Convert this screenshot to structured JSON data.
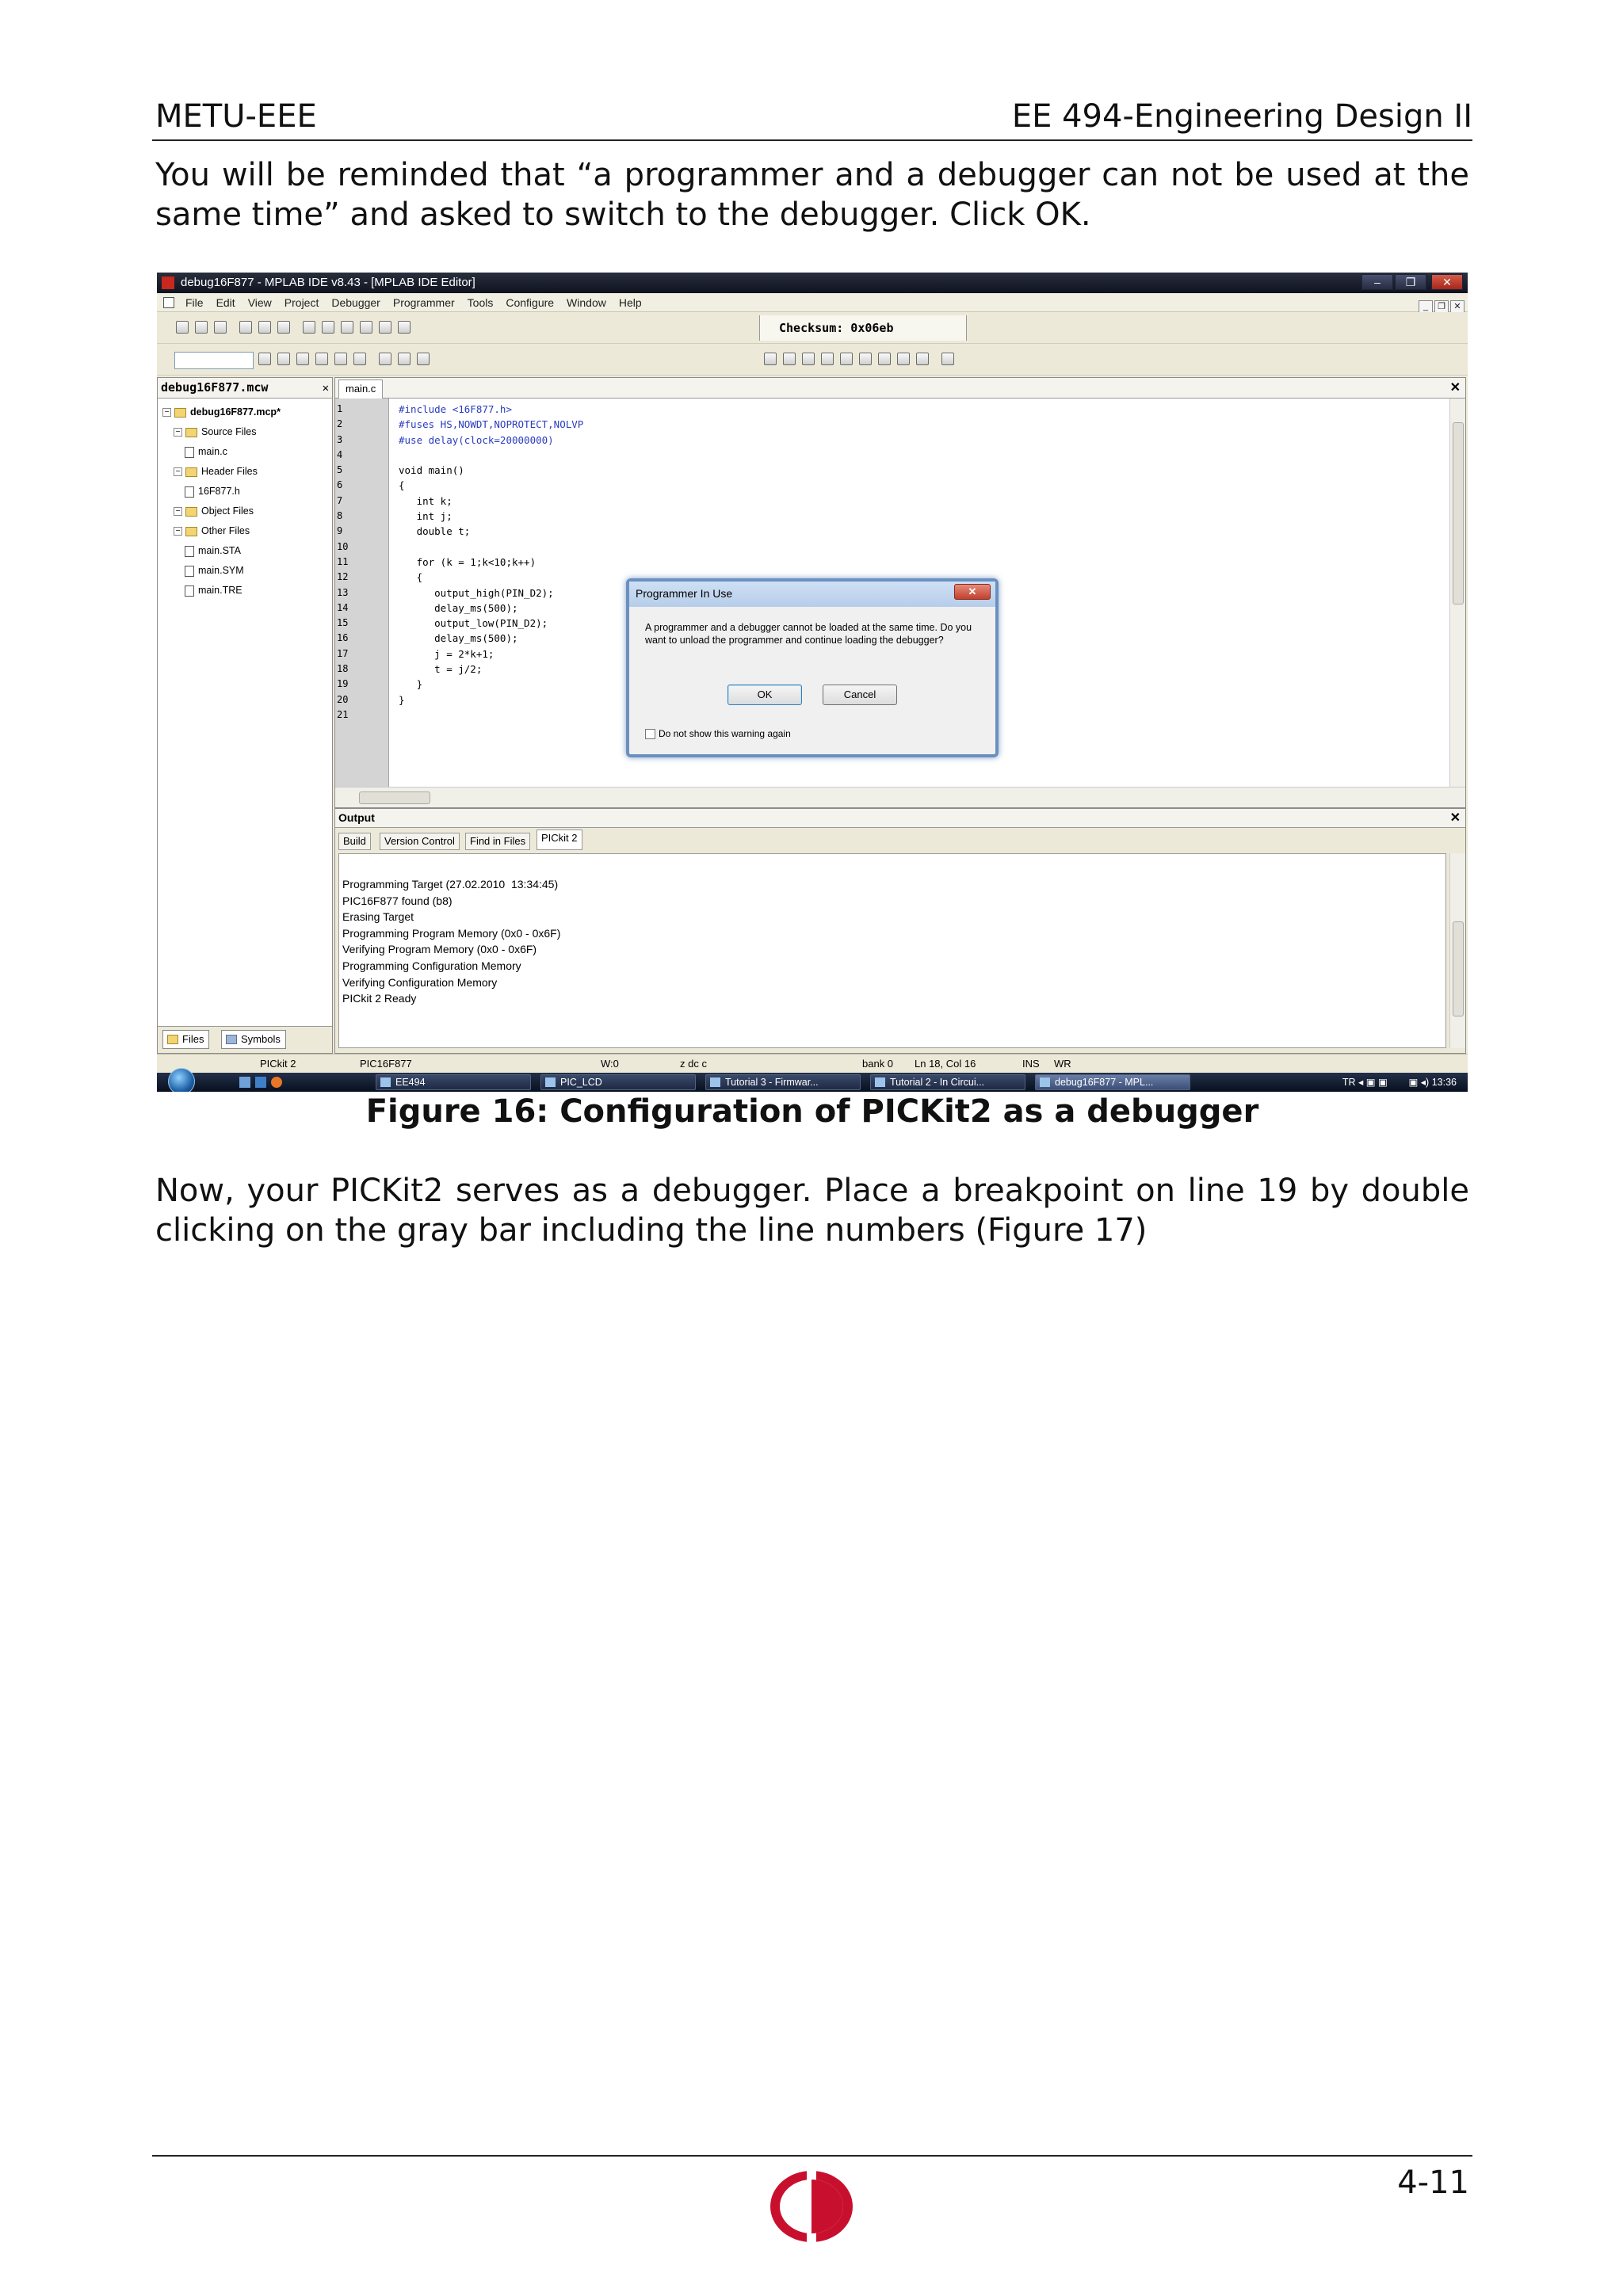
{
  "header": {
    "left": "METU-EEE",
    "right": "EE 494-Engineering Design II"
  },
  "paragraph1": "You will be reminded that “a programmer and a debugger can not be used at the same time” and asked to switch to the debugger. Click OK.",
  "figure": {
    "caption": "Figure 16: Configuration of PICKit2 as a debugger",
    "window_title": "debug16F877 - MPLAB IDE v8.43 - [MPLAB IDE Editor]",
    "menu": [
      "File",
      "Edit",
      "View",
      "Project",
      "Debugger",
      "Programmer",
      "Tools",
      "Configure",
      "Window",
      "Help"
    ],
    "checksum": "Checksum:  0x06eb",
    "project_panel": {
      "title": "debug16F877.mcw",
      "tree": [
        {
          "label": "debug16F877.mcp*",
          "kind": "folder",
          "depth": 0
        },
        {
          "label": "Source Files",
          "kind": "folder",
          "depth": 1
        },
        {
          "label": "main.c",
          "kind": "file",
          "depth": 2
        },
        {
          "label": "Header Files",
          "kind": "folder",
          "depth": 1
        },
        {
          "label": "16F877.h",
          "kind": "file",
          "depth": 2
        },
        {
          "label": "Object Files",
          "kind": "folder",
          "depth": 1
        },
        {
          "label": "Other Files",
          "kind": "folder",
          "depth": 1
        },
        {
          "label": "main.STA",
          "kind": "file",
          "depth": 2
        },
        {
          "label": "main.SYM",
          "kind": "file",
          "depth": 2
        },
        {
          "label": "main.TRE",
          "kind": "file",
          "depth": 2
        }
      ],
      "tabs": [
        "Files",
        "Symbols"
      ]
    },
    "editor": {
      "tab": "main.c",
      "line_numbers": [
        "1",
        "2",
        "3",
        "4",
        "5",
        "6",
        "7",
        "8",
        "9",
        "10",
        "11",
        "12",
        "13",
        "14",
        "15",
        "16",
        "17",
        "18",
        "19",
        "20",
        "21"
      ],
      "code": [
        "#include <16F877.h>",
        "#fuses HS,NOWDT,NOPROTECT,NOLVP",
        "#use delay(clock=20000000)",
        "",
        "void main()",
        "{",
        "   int k;",
        "   int j;",
        "   double t;",
        "",
        "   for (k = 1;k<10;k++)",
        "   {",
        "      output_high(PIN_D2);",
        "      delay_ms(500);",
        "      output_low(PIN_D2);",
        "      delay_ms(500);",
        "      j = 2*k+1;",
        "      t = j/2;",
        "   }",
        "}",
        ""
      ]
    },
    "dialog": {
      "title": "Programmer In Use",
      "message": "A programmer and a debugger cannot be loaded at the same time. Do you want to unload the programmer and continue loading the debugger?",
      "ok": "OK",
      "cancel": "Cancel",
      "checkbox": "Do not show this warning again"
    },
    "output": {
      "title": "Output",
      "tabs": [
        "Build",
        "Version Control",
        "Find in Files",
        "PICkit 2"
      ],
      "lines": [
        "Programming Target (27.02.2010  13:34:45)",
        "PIC16F877 found (b8)",
        "Erasing Target",
        "Programming Program Memory (0x0 - 0x6F)",
        "Verifying Program Memory (0x0 - 0x6F)",
        "Programming Configuration Memory",
        "Verifying Configuration Memory",
        "PICkit 2 Ready"
      ]
    },
    "status": [
      "PICkit 2",
      "PIC16F877",
      "W:0",
      "z dc c",
      "bank 0",
      "Ln 18, Col 16",
      "INS",
      "WR"
    ],
    "taskbar": {
      "tasks": [
        "EE494",
        "PIC_LCD",
        "Tutorial 3 - Firmwar...",
        "Tutorial 2 - In Circui...",
        "debug16F877 - MPL..."
      ],
      "lang": "TR",
      "time": "13:36"
    }
  },
  "paragraph2": "Now, your PICKit2 serves as a debugger. Place a breakpoint on line 19 by double clicking on the gray bar including the line numbers (Figure 17)",
  "footer": {
    "page": "4-11"
  }
}
